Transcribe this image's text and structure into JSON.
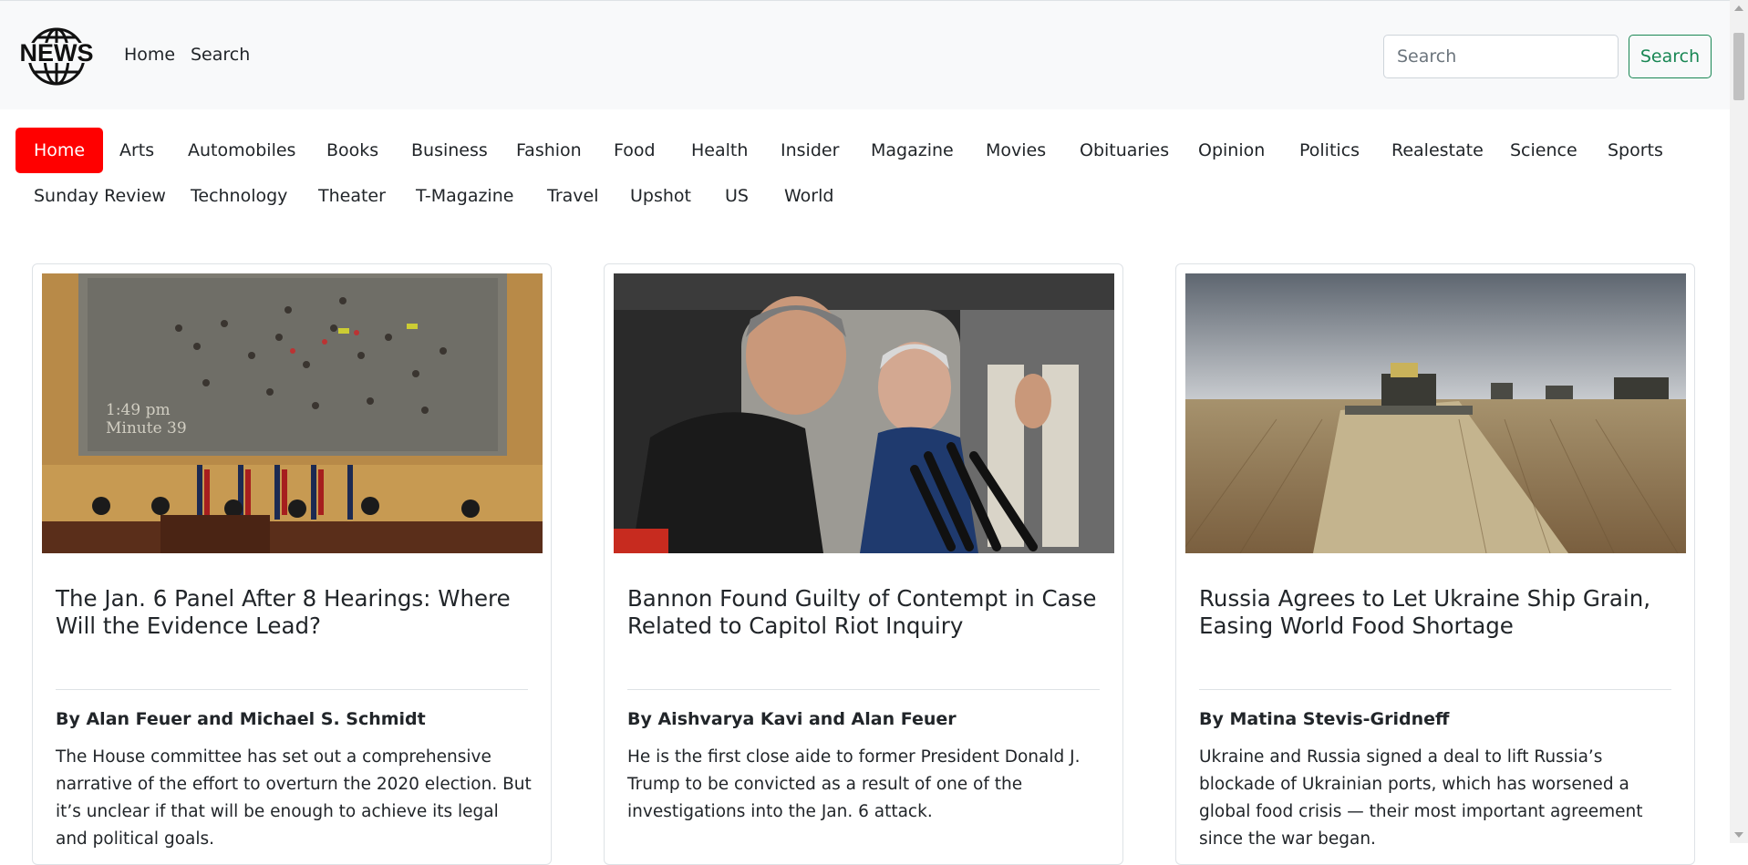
{
  "brand": {
    "logo_text": "NEWS"
  },
  "nav": {
    "home": "Home",
    "search": "Search"
  },
  "search": {
    "placeholder": "Search",
    "button": "Search"
  },
  "categories": [
    "Home",
    "Arts",
    "Automobiles",
    "Books",
    "Business",
    "Fashion",
    "Food",
    "Health",
    "Insider",
    "Magazine",
    "Movies",
    "Obituaries",
    "Opinion",
    "Politics",
    "Realestate",
    "Science",
    "Sports",
    "Sunday Review",
    "Technology",
    "Theater",
    "T-Magazine",
    "Travel",
    "Upshot",
    "US",
    "World"
  ],
  "active_category": "Home",
  "colors": {
    "active_category_bg": "#ff0000",
    "search_button": "#198754",
    "navbar_bg": "#f8f9fa"
  },
  "articles": [
    {
      "title": "The Jan. 6 Panel After 8 Hearings: Where Will the Evidence Lead?",
      "byline": "By Alan Feuer and Michael S. Schmidt",
      "abstract": "The House committee has set out a comprehensive narrative of the effort to overturn the 2020 election. But it’s unclear if that will be enough to achieve its legal and political goals.",
      "image_caption": "1:49 pm Minute 39"
    },
    {
      "title": "Bannon Found Guilty of Contempt in Case Related to Capitol Riot Inquiry",
      "byline": "By Aishvarya Kavi and Alan Feuer",
      "abstract": "He is the first close aide to former President Donald J. Trump to be convicted as a result of one of the investigations into the Jan. 6 attack."
    },
    {
      "title": "Russia Agrees to Let Ukraine Ship Grain, Easing World Food Shortage",
      "byline": "By Matina Stevis-Gridneff",
      "abstract": "Ukraine and Russia signed a deal to lift Russia’s blockade of Ukrainian ports, which has worsened a global food crisis — their most important agreement since the war began."
    }
  ]
}
